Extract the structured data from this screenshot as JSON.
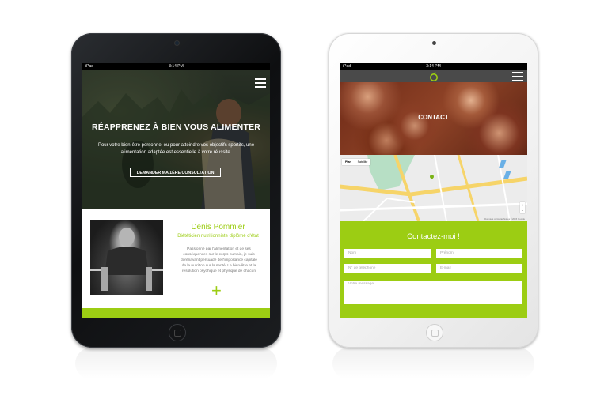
{
  "left_device": {
    "status": {
      "left": "iPad",
      "time": "3:14 PM",
      "right": ""
    },
    "hero": {
      "title": "RÉAPPRENEZ À BIEN VOUS ALIMENTER",
      "text": "Pour votre bien-être personnel ou pour atteindre vos objectifs sportifs, une alimentation adaptée est essentielle à votre réussite.",
      "button": "DEMANDER MA 1ÈRE CONSULTATION"
    },
    "about": {
      "name": "Denis Pommier",
      "subtitle": "Diététicien nutritionniste diplômé d'état",
      "bio": "Passionné par l'alimentation et de ses conséquences sur le corps humain, je suis dorénavant persuadé de l'importance capitale de la nutrition sur la santé. Le bien-être et la résolution psychique et physique de chacun",
      "plus": "+"
    }
  },
  "right_device": {
    "status": {
      "left": "iPad",
      "time": "3:14 PM",
      "right": ""
    },
    "banner_title": "CONTACT",
    "map": {
      "tabs": [
        "Plan",
        "Satellite"
      ],
      "zoom_in": "+",
      "zoom_out": "−",
      "footer": "Données cartographiques ©2015 Google"
    },
    "form": {
      "title": "Contactez-moi !",
      "nom": "Nom",
      "prenom": "Prénom",
      "telephone": "N° de téléphone",
      "email": "E-mail",
      "message": "Votre message..."
    }
  },
  "colors": {
    "accent": "#9ccd13",
    "dark_bar": "#4a4a4a"
  },
  "icons": [
    "menu-icon",
    "logo-icon",
    "map-pin-icon",
    "home-button"
  ]
}
